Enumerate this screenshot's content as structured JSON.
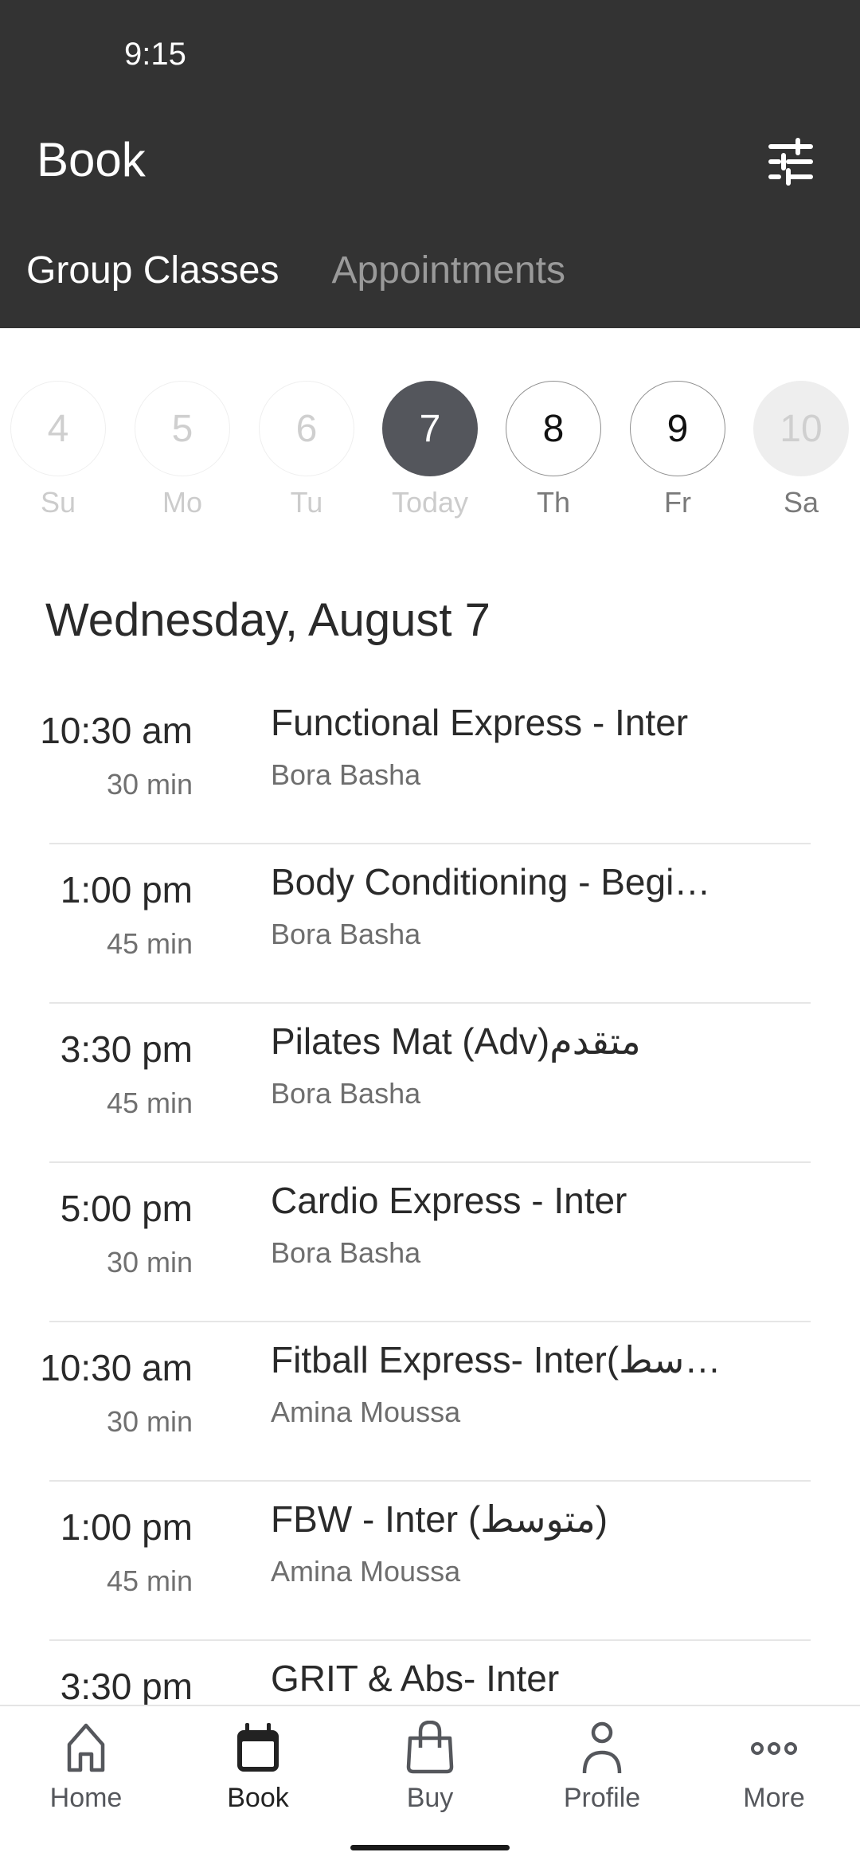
{
  "status_bar": {
    "time": "9:15"
  },
  "header": {
    "title": "Book",
    "filter_icon": "sliders-icon",
    "tabs": [
      {
        "label": "Group Classes",
        "active": true
      },
      {
        "label": "Appointments",
        "active": false
      }
    ]
  },
  "week": {
    "days": [
      {
        "number": "4",
        "label": "Su",
        "state": "past"
      },
      {
        "number": "5",
        "label": "Mo",
        "state": "past"
      },
      {
        "number": "6",
        "label": "Tu",
        "state": "past"
      },
      {
        "number": "7",
        "label": "Today",
        "state": "selected"
      },
      {
        "number": "8",
        "label": "Th",
        "state": "future"
      },
      {
        "number": "9",
        "label": "Fr",
        "state": "future"
      },
      {
        "number": "10",
        "label": "Sa",
        "state": "disabled"
      }
    ]
  },
  "schedule": {
    "date_heading": "Wednesday, August 7",
    "classes": [
      {
        "time": "10:30 am",
        "duration": "30 min",
        "name": "Functional Express - Inter",
        "instructor": "Bora Basha"
      },
      {
        "time": "1:00 pm",
        "duration": "45 min",
        "name": "Body Conditioning - Begi…",
        "instructor": "Bora Basha"
      },
      {
        "time": "3:30 pm",
        "duration": "45 min",
        "name": "Pilates Mat (Adv)متقدم",
        "instructor": "Bora Basha"
      },
      {
        "time": "5:00 pm",
        "duration": "30 min",
        "name": "Cardio Express - Inter",
        "instructor": "Bora Basha"
      },
      {
        "time": "10:30 am",
        "duration": "30 min",
        "name": "Fitball Express- Inter(سط…",
        "instructor": "Amina Moussa"
      },
      {
        "time": "1:00 pm",
        "duration": "45 min",
        "name": "FBW - Inter (متوسط)",
        "instructor": "Amina Moussa"
      },
      {
        "time": "3:30 pm",
        "duration": "",
        "name": "GRIT & Abs- Inter",
        "instructor": ""
      }
    ]
  },
  "bottom_nav": {
    "items": [
      {
        "label": "Home",
        "icon": "home-icon",
        "active": false
      },
      {
        "label": "Book",
        "icon": "calendar-icon",
        "active": true
      },
      {
        "label": "Buy",
        "icon": "shopping-bag-icon",
        "active": false
      },
      {
        "label": "Profile",
        "icon": "person-icon",
        "active": false
      },
      {
        "label": "More",
        "icon": "more-dots-icon",
        "active": false
      }
    ]
  },
  "colors": {
    "header_bg": "#333333",
    "selected_day": "#54565c",
    "divider": "#e6e6e6"
  }
}
